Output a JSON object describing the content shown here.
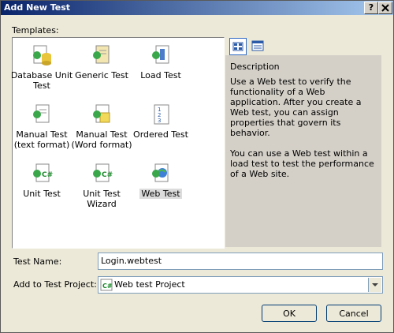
{
  "window": {
    "title": "Add New Test",
    "help_label": "?",
    "close_label": "X"
  },
  "templates": {
    "label": "Templates:",
    "items": [
      {
        "label_line1": "Database Unit",
        "label_line2": "Test",
        "icon": "database-unit-test-icon"
      },
      {
        "label_line1": "Generic Test",
        "label_line2": "",
        "icon": "generic-test-icon"
      },
      {
        "label_line1": "Load Test",
        "label_line2": "",
        "icon": "load-test-icon"
      },
      {
        "label_line1": "Manual Test",
        "label_line2": "(text format)",
        "icon": "manual-test-text-icon"
      },
      {
        "label_line1": "Manual Test",
        "label_line2": "(Word format)",
        "icon": "manual-test-word-icon"
      },
      {
        "label_line1": "Ordered Test",
        "label_line2": "",
        "icon": "ordered-test-icon"
      },
      {
        "label_line1": "Unit Test",
        "label_line2": "",
        "icon": "unit-test-icon"
      },
      {
        "label_line1": "Unit Test",
        "label_line2": "Wizard",
        "icon": "unit-test-wizard-icon"
      },
      {
        "label_line1": "Web Test",
        "label_line2": "",
        "icon": "web-test-icon",
        "selected": true
      }
    ]
  },
  "views": {
    "large_icons": "large-icons-view-icon",
    "list": "list-view-icon"
  },
  "description": {
    "title": "Description",
    "text1": "Use a Web test to verify the functionality of a Web application. After you create a Web test, you can assign properties that govern its behavior.",
    "text2": "You can use a Web test within a load test to test the performance of a Web site."
  },
  "test_name": {
    "label": "Test Name:",
    "value": "Login.webtest"
  },
  "project": {
    "label": "Add to Test Project:",
    "value": "Web test Project",
    "icon": "csharp-project-icon"
  },
  "buttons": {
    "ok": "OK",
    "cancel": "Cancel"
  }
}
